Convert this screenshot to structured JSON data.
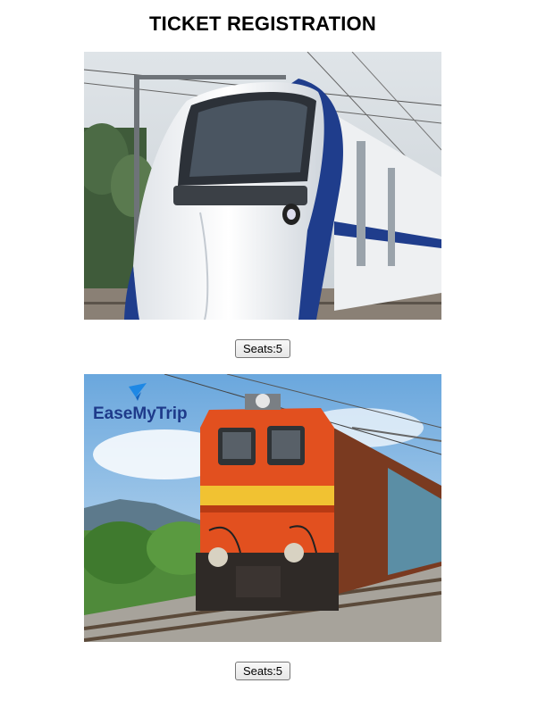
{
  "page": {
    "title": "TICKET REGISTRATION"
  },
  "trains": [
    {
      "image": "vande-bharat-train-photo",
      "seats_label": "Seats:5"
    },
    {
      "image": "orange-locomotive-train-photo",
      "watermark_logo": "EaseMyTrip",
      "seats_label": "Seats:5"
    }
  ],
  "colors": {
    "train1_body": "#f3f5f7",
    "train1_stripe": "#1f3d8c",
    "train2_body": "#e2501f",
    "train2_stripe": "#f1c232",
    "sky2": "#7fb4e0"
  }
}
